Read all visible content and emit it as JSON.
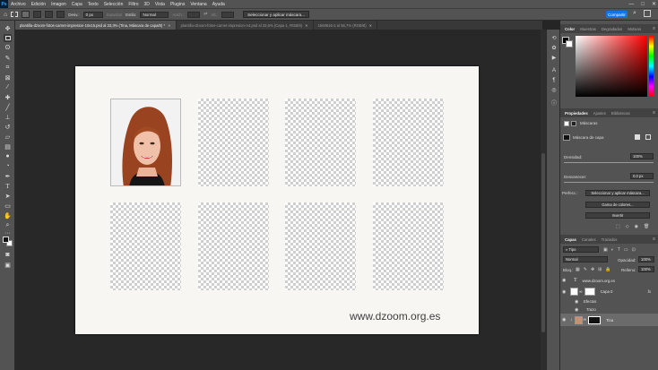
{
  "menubar": {
    "logo": "Ps",
    "items": [
      "Archivo",
      "Edición",
      "Imagen",
      "Capa",
      "Texto",
      "Selección",
      "Filtro",
      "3D",
      "Vista",
      "Plugins",
      "Ventana",
      "Ayuda"
    ],
    "controls": [
      "—",
      "□",
      "✕"
    ]
  },
  "options": {
    "calado_label": "Desv.:",
    "calado_value": "0 px",
    "suavizar_label": "Suavizar",
    "estilo_label": "Estilo:",
    "estilo_value": "Normal",
    "anch_label": "Anch.:",
    "alt_label": "Alt.:",
    "select_mask_button": "Seleccionar y aplicar máscara...",
    "share_button": "Compartir"
  },
  "tabs": [
    {
      "label": "plantilla-dzoom-fotos-carnet-impresion-10x15.psd al 33,3% (Tina, Máscara de capa/8) *",
      "active": true
    },
    {
      "label": "plantilla-dzoom-fotos-carnet-impresion-A4.psd al 33,6% (Capa 1, RGB/8)",
      "active": false
    },
    {
      "label": "1560616-2 al 56,7% (RGB/8)",
      "active": false
    }
  ],
  "document": {
    "watermark": "www.dzoom.org.es"
  },
  "color_panel": {
    "tabs": [
      "Color",
      "Muestras",
      "Degradados",
      "Motivos"
    ]
  },
  "properties_panel": {
    "tabs": [
      "Propiedades",
      "Ajustes",
      "Bibliotecas"
    ],
    "section_label": "Máscaras",
    "mask_label": "Máscara de capa",
    "density_label": "Densidad:",
    "density_value": "100%",
    "feather_label": "Desvanecer:",
    "feather_value": "0,0 px",
    "refine_label": "Perfecc.:",
    "btn_select_mask": "Seleccionar y aplicar máscara...",
    "btn_color_range": "Gama de colores...",
    "btn_invert": "Invertir"
  },
  "layers_panel": {
    "tabs": [
      "Capas",
      "Canales",
      "Trazados"
    ],
    "filter_value": "Tipo",
    "blend_mode": "Normal",
    "opacity_label": "Opacidad:",
    "opacity_value": "100%",
    "lock_label": "Bloq.:",
    "fill_label": "Relleno:",
    "fill_value": "100%",
    "layers": [
      {
        "name": "www.dzoom.org.es",
        "kind": "text"
      },
      {
        "name": "Capa 0",
        "kind": "group"
      },
      {
        "name": "Efectos",
        "kind": "effects"
      },
      {
        "name": "Trazo",
        "kind": "effect"
      },
      {
        "name": "Tina",
        "kind": "image",
        "selected": true
      }
    ]
  }
}
